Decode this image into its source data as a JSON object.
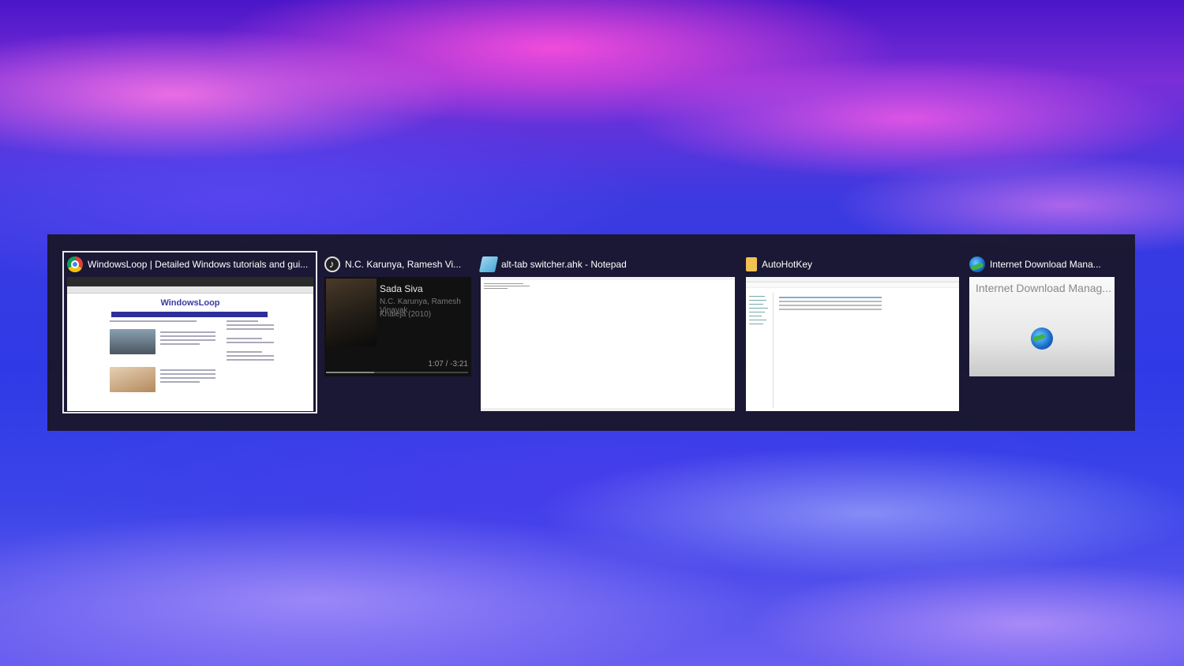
{
  "switcher": {
    "windows": [
      {
        "title": "WindowsLoop | Detailed Windows tutorials and gui...",
        "icon": "chrome-icon",
        "selected": true,
        "thumbnail": {
          "site_logo": "WindowsLoop"
        }
      },
      {
        "title": "N.C. Karunya, Ramesh Vi...",
        "icon": "music-player-icon",
        "selected": false,
        "thumbnail": {
          "song": "Sada Siva",
          "artist": "N.C. Karunya, Ramesh Vinayak",
          "album": "Khaleja (2010)",
          "time": "1:07 / -3:21",
          "progress": 0.34
        }
      },
      {
        "title": "alt-tab switcher.ahk - Notepad",
        "icon": "notepad-icon",
        "selected": false
      },
      {
        "title": "AutoHotKey",
        "icon": "folder-icon",
        "selected": false
      },
      {
        "title": "Internet Download Mana...",
        "icon": "idm-icon",
        "selected": false,
        "thumbnail": {
          "title": "Internet Download Manag..."
        }
      }
    ]
  },
  "colors": {
    "switcher_bg": "#18162a",
    "selection_border": "#e8e8f0"
  }
}
